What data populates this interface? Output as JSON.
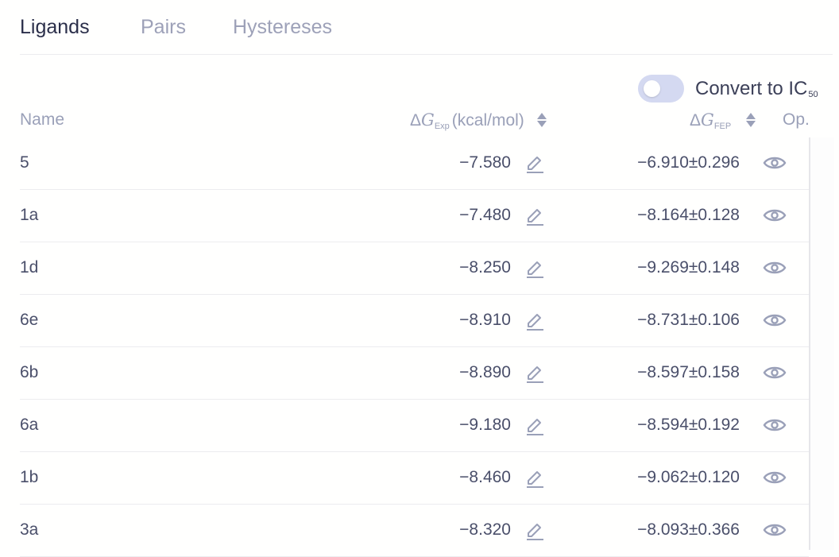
{
  "tabs": [
    {
      "label": "Ligands",
      "active": true
    },
    {
      "label": "Pairs",
      "active": false
    },
    {
      "label": "Hystereses",
      "active": false
    }
  ],
  "toggle": {
    "label": "Convert to IC",
    "label_sub": "50",
    "on": false
  },
  "columns": {
    "name": "Name",
    "exp_delta": "Δ",
    "exp_G": "G",
    "exp_sub": "Exp",
    "exp_unit": "(kcal/mol)",
    "fep_delta": "Δ",
    "fep_G": "G",
    "fep_sub": "FEP",
    "op": "Op."
  },
  "rows": [
    {
      "name": "5",
      "exp": "−7.580",
      "fep": "−6.910±0.296"
    },
    {
      "name": "1a",
      "exp": "−7.480",
      "fep": "−8.164±0.128"
    },
    {
      "name": "1d",
      "exp": "−8.250",
      "fep": "−9.269±0.148"
    },
    {
      "name": "6e",
      "exp": "−8.910",
      "fep": "−8.731±0.106"
    },
    {
      "name": "6b",
      "exp": "−8.890",
      "fep": "−8.597±0.158"
    },
    {
      "name": "6a",
      "exp": "−9.180",
      "fep": "−8.594±0.192"
    },
    {
      "name": "1b",
      "exp": "−8.460",
      "fep": "−9.062±0.120"
    },
    {
      "name": "3a",
      "exp": "−8.320",
      "fep": "−8.093±0.366"
    }
  ],
  "icons": {
    "edit": "pencil-icon",
    "view": "eye-icon"
  },
  "colors": {
    "accent": "#d4d9f1",
    "text": "#4a4f6a",
    "muted": "#9aa0b8"
  }
}
